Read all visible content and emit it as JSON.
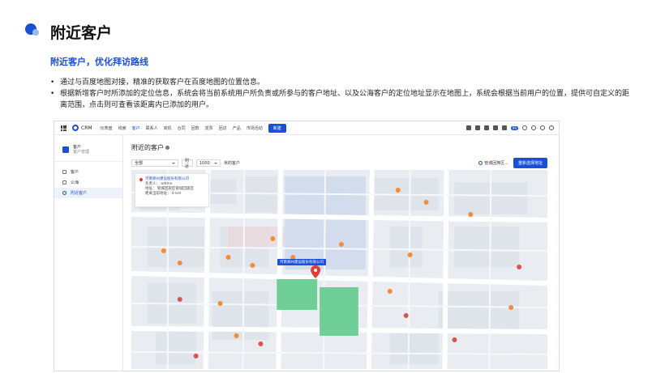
{
  "slide": {
    "title": "附近客户",
    "subtitle": "附近客户，优化拜访路线",
    "bullets": [
      "通过与百度地图对接，精准的获取客户在百度地图的位置信息。",
      "根据新增客户时所添加的定位信息，系统会将当前系统用户所负责或所参与的客户地址、以及公海客户的定位地址显示在地图上，系统会根据当前用户的位置，提供可自定义的距离范围，点击则可查看该距离内已添加的用户。"
    ],
    "accent_color": "#1a4fd8"
  },
  "app": {
    "logo_text": "CRM",
    "nav": [
      "仪表盘",
      "线索",
      "客户",
      "联系人",
      "商机",
      "合同",
      "回款",
      "发票",
      "回访",
      "产品",
      "市场活动"
    ],
    "new_button": "新建",
    "badge_count": "99",
    "sidebar": {
      "head_title": "客户",
      "head_sub": "客户管理",
      "items": [
        {
          "label": "客户",
          "icon": "customer-icon"
        },
        {
          "label": "公海",
          "icon": "sea-icon"
        },
        {
          "label": "附近客户",
          "icon": "location-icon"
        }
      ]
    },
    "page_title": "附近的客户",
    "filters": {
      "scope": "全部",
      "nearby_label": "附近",
      "distance": "1000",
      "unit_text": "米的客户"
    },
    "location_label": "管城回族区...",
    "choose_button": "重新选择地址",
    "card": {
      "name": "河南郑州建设股份有限公司",
      "owner": "负责人： admin",
      "address": "地址： 管城回族区管城回族区",
      "distance": "距离当前地址： 0 km"
    },
    "map_marker_label": "河南郑州建设股份有限公司"
  }
}
